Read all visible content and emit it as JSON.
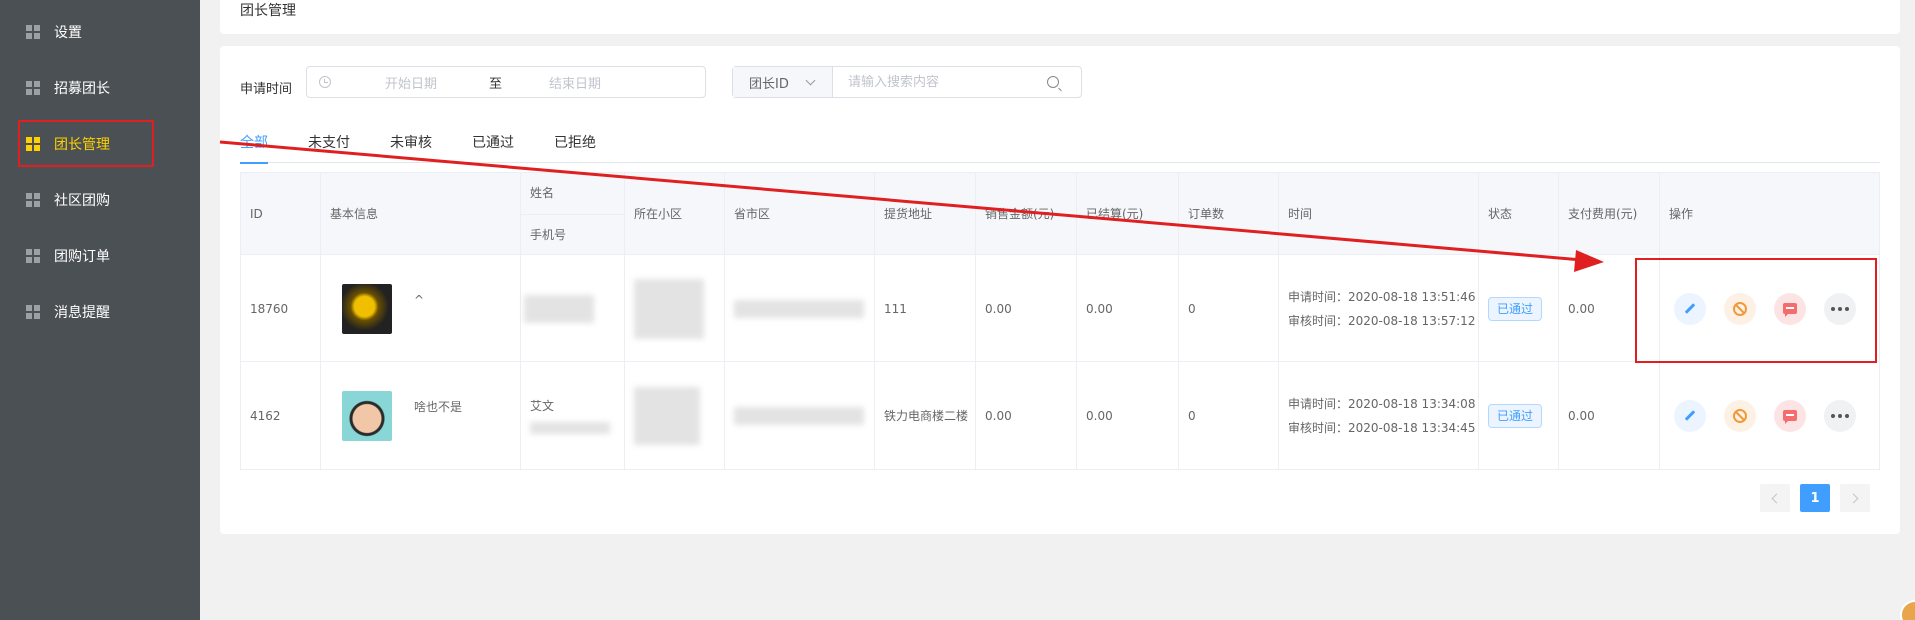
{
  "sidebar": {
    "items": [
      {
        "label": "设置",
        "active": false
      },
      {
        "label": "招募团长",
        "active": false
      },
      {
        "label": "团长管理",
        "active": true
      },
      {
        "label": "社区团购",
        "active": false
      },
      {
        "label": "团购订单",
        "active": false
      },
      {
        "label": "消息提醒",
        "active": false
      }
    ]
  },
  "breadcrumb": {
    "title": "团长管理"
  },
  "filter": {
    "date_label": "申请时间",
    "start_placeholder": "开始日期",
    "range_separator": "至",
    "end_placeholder": "结束日期",
    "search_field": "团长ID",
    "search_placeholder": "请输入搜索内容"
  },
  "tabs": [
    {
      "label": "全部",
      "active": true
    },
    {
      "label": "未支付",
      "active": false
    },
    {
      "label": "未审核",
      "active": false
    },
    {
      "label": "已通过",
      "active": false
    },
    {
      "label": "已拒绝",
      "active": false
    }
  ],
  "table": {
    "headers": {
      "id": "ID",
      "basic": "基本信息",
      "name": "姓名",
      "phone": "手机号",
      "community": "所在小区",
      "region": "省市区",
      "pickup": "提货地址",
      "sales": "销售金额(元)",
      "settled": "已结算(元)",
      "orders": "订单数",
      "time": "时间",
      "status": "状态",
      "fee": "支付费用(元)",
      "ops": "操作"
    },
    "rows": [
      {
        "id": "18760",
        "nickname": "^",
        "avatar": "dark-avatar",
        "name": "",
        "pickup": "111",
        "sales": "0.00",
        "settled": "0.00",
        "orders": "0",
        "apply_time": "申请时间：2020-08-18 13:51:46",
        "review_time": "审核时间：2020-08-18 13:57:12",
        "status": "已通过",
        "fee": "0.00"
      },
      {
        "id": "4162",
        "nickname": "啥也不是",
        "avatar": "kid-avatar",
        "name": "艾文",
        "pickup": "铁力电商楼二楼",
        "sales": "0.00",
        "settled": "0.00",
        "orders": "0",
        "apply_time": "申请时间：2020-08-18 13:34:08",
        "review_time": "审核时间：2020-08-18 13:34:45",
        "status": "已通过",
        "fee": "0.00"
      }
    ],
    "actions": [
      "edit-icon",
      "ban-icon",
      "message-icon",
      "more-icon"
    ]
  },
  "pagination": {
    "current": "1"
  },
  "colors": {
    "accent": "#409eff",
    "sidebar": "#4b5055",
    "sidebar_active": "#ffd100",
    "annotation": "#e02020"
  }
}
